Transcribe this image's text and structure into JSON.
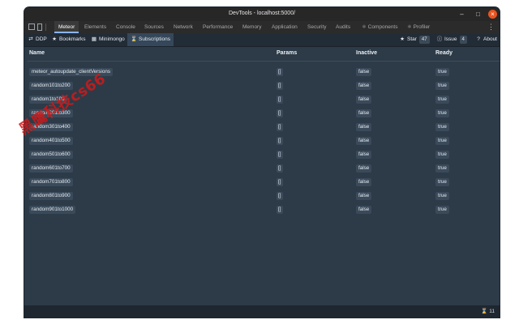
{
  "window": {
    "title": "DevTools - localhost:5000/"
  },
  "devtools_tabs": [
    "Meteor",
    "Elements",
    "Console",
    "Sources",
    "Network",
    "Performance",
    "Memory",
    "Application",
    "Security",
    "Audits",
    "⚛ Components",
    "⚛ Profiler"
  ],
  "meteor_tabs": [
    {
      "label": "DDP",
      "icon": "ddp-icon"
    },
    {
      "label": "Bookmarks",
      "icon": "star-icon"
    },
    {
      "label": "Minimongo",
      "icon": "database-icon"
    },
    {
      "label": "Subscriptions",
      "icon": "subscriptions-icon"
    }
  ],
  "right_actions": {
    "star_label": "Star",
    "star_count": "47",
    "issue_label": "Issue",
    "issue_count": "4",
    "about_label": "About"
  },
  "table": {
    "headers": {
      "name": "Name",
      "params": "Params",
      "inactive": "Inactive",
      "ready": "Ready"
    },
    "rows": [
      {
        "name": "meteor_autoupdate_clientVersions",
        "params": "[]",
        "inactive": "false",
        "ready": "true"
      },
      {
        "name": "random101to200",
        "params": "[]",
        "inactive": "false",
        "ready": "true"
      },
      {
        "name": "random1to100",
        "params": "[]",
        "inactive": "false",
        "ready": "true"
      },
      {
        "name": "random201to300",
        "params": "[]",
        "inactive": "false",
        "ready": "true"
      },
      {
        "name": "random301to400",
        "params": "[]",
        "inactive": "false",
        "ready": "true"
      },
      {
        "name": "random401to500",
        "params": "[]",
        "inactive": "false",
        "ready": "true"
      },
      {
        "name": "random501to600",
        "params": "[]",
        "inactive": "false",
        "ready": "true"
      },
      {
        "name": "random601to700",
        "params": "[]",
        "inactive": "false",
        "ready": "true"
      },
      {
        "name": "random701to800",
        "params": "[]",
        "inactive": "false",
        "ready": "true"
      },
      {
        "name": "random801to900",
        "params": "[]",
        "inactive": "false",
        "ready": "true"
      },
      {
        "name": "random901to1000",
        "params": "[]",
        "inactive": "false",
        "ready": "true"
      }
    ]
  },
  "footer": {
    "subscription_count": "11"
  },
  "watermark": "黑鹰科技cs66",
  "colors": {
    "panel": "#2d3b48",
    "chip": "#3a4a5a",
    "accent": "#e95420"
  }
}
